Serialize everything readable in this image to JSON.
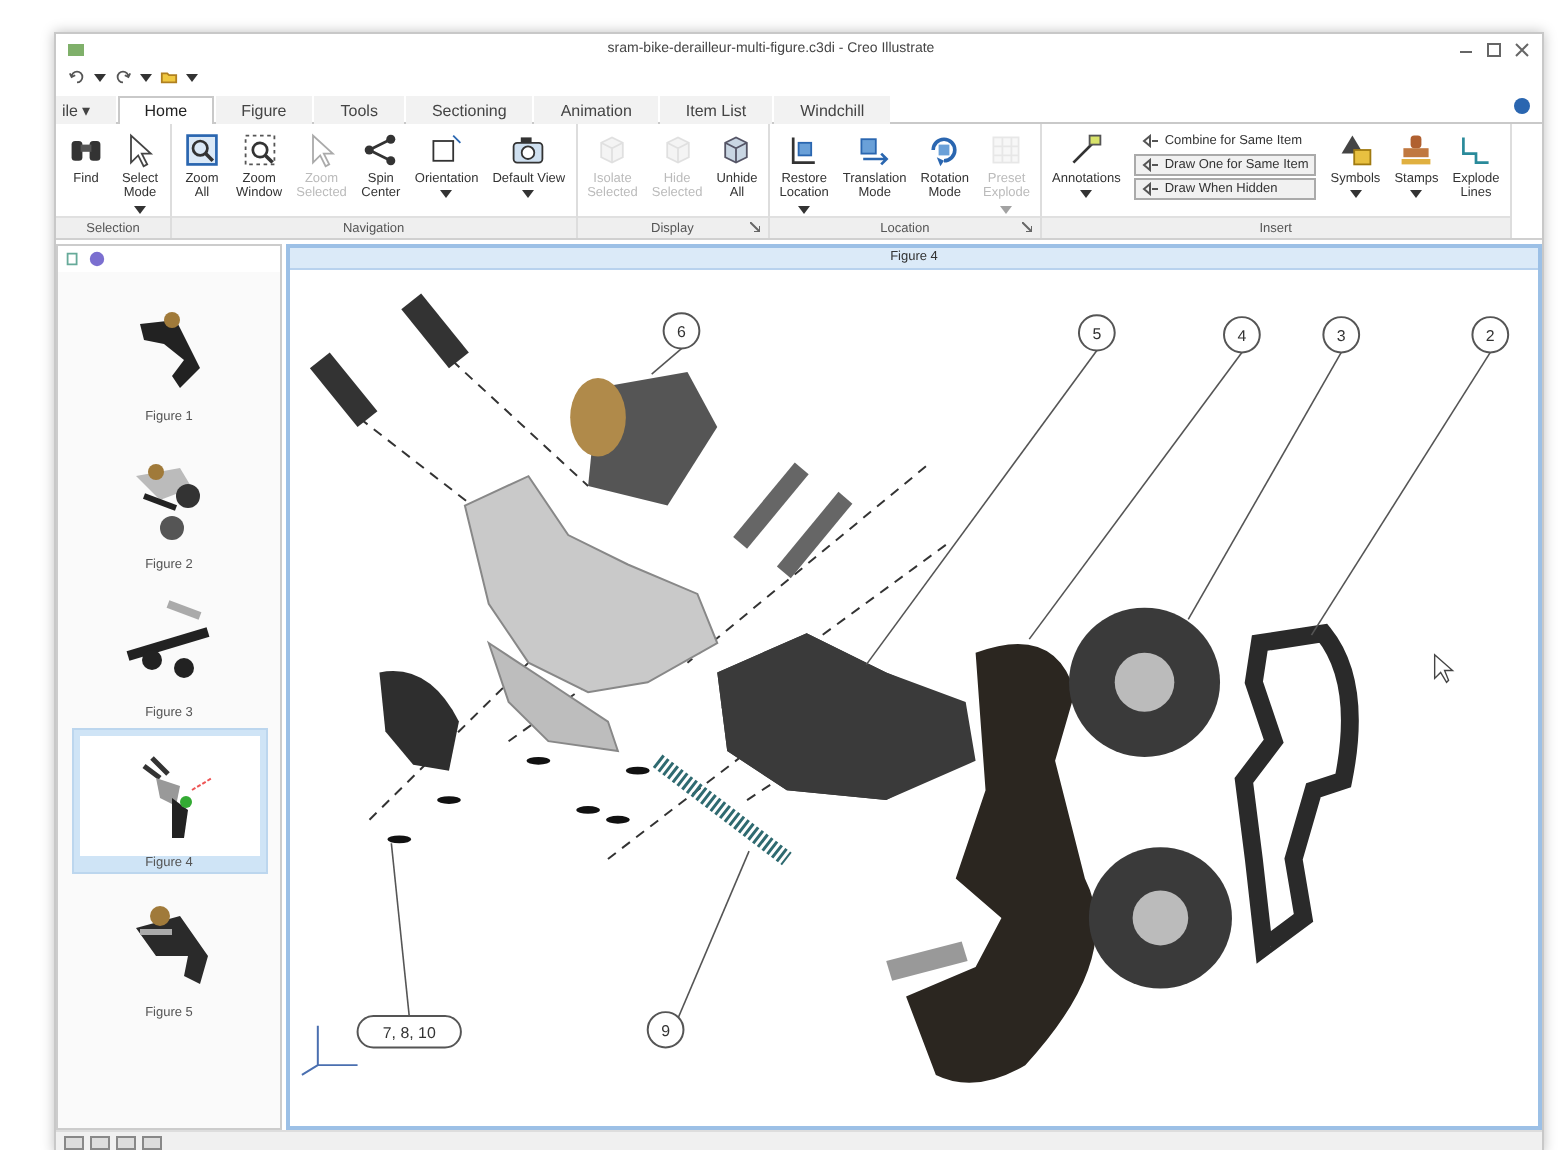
{
  "window": {
    "title": "sram-bike-derailleur-multi-figure.c3di - Creo Illustrate"
  },
  "tabs": [
    {
      "label": "ile ▾",
      "selected": false
    },
    {
      "label": "Home",
      "selected": true
    },
    {
      "label": "Figure",
      "selected": false
    },
    {
      "label": "Tools",
      "selected": false
    },
    {
      "label": "Sectioning",
      "selected": false
    },
    {
      "label": "Animation",
      "selected": false
    },
    {
      "label": "Item List",
      "selected": false
    },
    {
      "label": "Windchill",
      "selected": false
    }
  ],
  "ribbon": {
    "groups": [
      {
        "label": "Selection",
        "launcher": false,
        "buttons": [
          {
            "kind": "large",
            "label": "Find",
            "dropdown": false,
            "disabled": false
          },
          {
            "kind": "large",
            "label": "Select\nMode",
            "dropdown": true,
            "disabled": false
          }
        ]
      },
      {
        "label": "Navigation",
        "launcher": false,
        "buttons": [
          {
            "kind": "large",
            "label": "Zoom\nAll",
            "dropdown": false,
            "disabled": false
          },
          {
            "kind": "large",
            "label": "Zoom\nWindow",
            "dropdown": false,
            "disabled": false
          },
          {
            "kind": "large",
            "label": "Zoom\nSelected",
            "dropdown": false,
            "disabled": true
          },
          {
            "kind": "large",
            "label": "Spin\nCenter",
            "dropdown": false,
            "disabled": false
          },
          {
            "kind": "large",
            "label": "Orientation",
            "dropdown": true,
            "disabled": false
          },
          {
            "kind": "large",
            "label": "Default View",
            "dropdown": true,
            "disabled": false
          }
        ]
      },
      {
        "label": "Display",
        "launcher": true,
        "buttons": [
          {
            "kind": "large",
            "label": "Isolate\nSelected",
            "dropdown": false,
            "disabled": true
          },
          {
            "kind": "large",
            "label": "Hide\nSelected",
            "dropdown": false,
            "disabled": true
          },
          {
            "kind": "large",
            "label": "Unhide\nAll",
            "dropdown": false,
            "disabled": false
          }
        ]
      },
      {
        "label": "Location",
        "launcher": true,
        "buttons": [
          {
            "kind": "large",
            "label": "Restore\nLocation",
            "dropdown": true,
            "disabled": false
          },
          {
            "kind": "large",
            "label": "Translation\nMode",
            "dropdown": false,
            "disabled": false
          },
          {
            "kind": "large",
            "label": "Rotation\nMode",
            "dropdown": false,
            "disabled": false
          },
          {
            "kind": "large",
            "label": "Preset\nExplode",
            "dropdown": true,
            "disabled": true
          }
        ]
      },
      {
        "label": "Insert",
        "launcher": false,
        "buttons": [
          {
            "kind": "large",
            "label": "Annotations",
            "dropdown": true,
            "disabled": false
          },
          {
            "kind": "small",
            "label": "Combine for Same Item",
            "selected": false
          },
          {
            "kind": "small",
            "label": "Draw One for Same Item",
            "selected": true
          },
          {
            "kind": "small",
            "label": "Draw When Hidden",
            "selected": true
          },
          {
            "kind": "large",
            "label": "Symbols",
            "dropdown": true,
            "disabled": false
          },
          {
            "kind": "large",
            "label": "Stamps",
            "dropdown": true,
            "disabled": false
          },
          {
            "kind": "large",
            "label": "Explode\nLines",
            "dropdown": false,
            "disabled": false
          }
        ]
      }
    ]
  },
  "figures_panel": {
    "figures": [
      {
        "label": "Figure 1",
        "selected": false
      },
      {
        "label": "Figure 2",
        "selected": false
      },
      {
        "label": "Figure 3",
        "selected": false
      },
      {
        "label": "Figure 4",
        "selected": true
      },
      {
        "label": "Figure 5",
        "selected": false
      }
    ]
  },
  "viewport": {
    "title": "Figure 4",
    "callouts": [
      {
        "kind": "circle",
        "label": "6"
      },
      {
        "kind": "circle",
        "label": "5"
      },
      {
        "kind": "circle",
        "label": "4"
      },
      {
        "kind": "circle",
        "label": "3"
      },
      {
        "kind": "circle",
        "label": "2"
      },
      {
        "kind": "circle",
        "label": "9"
      },
      {
        "kind": "box",
        "label": "7, 8, 10"
      }
    ]
  }
}
